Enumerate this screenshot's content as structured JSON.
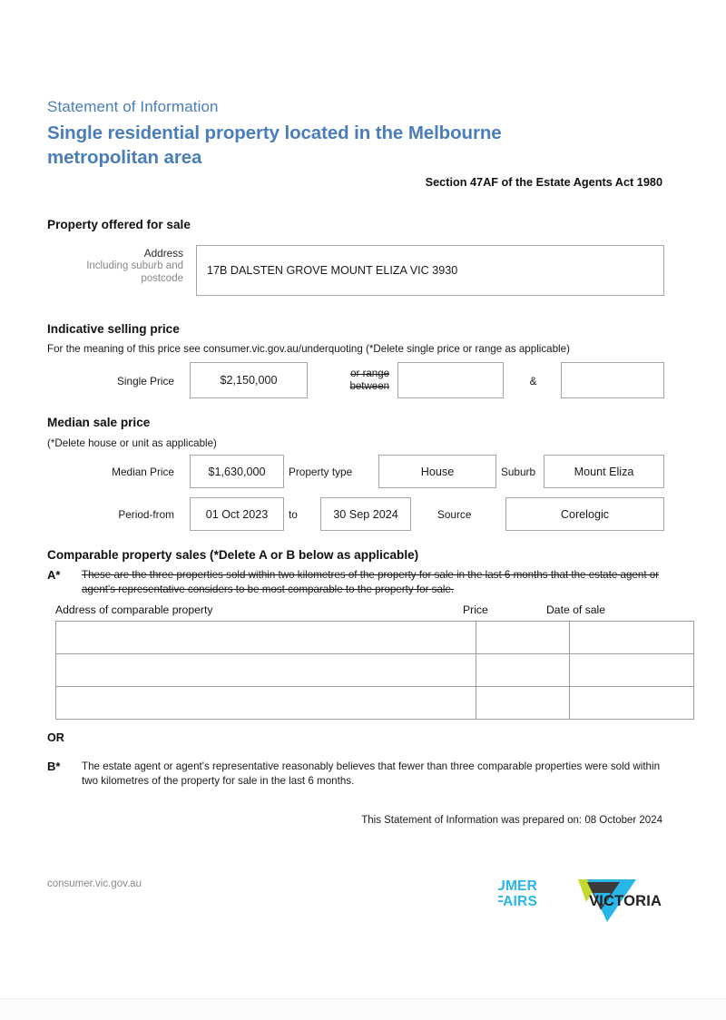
{
  "header": {
    "eyebrow": "Statement of Information",
    "title": "Single residential property located in the Melbourne metropolitan area",
    "section_ref": "Section 47AF of the Estate Agents Act 1980",
    "title_color": "#4a7ebb"
  },
  "property_offered": {
    "heading": "Property offered for sale",
    "address_label": "Address",
    "address_sublabel": "Including suburb and postcode",
    "address_value": "17B DALSTEN GROVE MOUNT ELIZA VIC 3930"
  },
  "indicative_price": {
    "heading": "Indicative selling price",
    "note": "For the meaning of this price see consumer.vic.gov.au/underquoting (*Delete single price or range as applicable)",
    "single_price_label": "Single Price",
    "single_price_value": "$2,150,000",
    "or_range_label_line1": "or range",
    "or_range_label_line2": "between",
    "range_low_value": "",
    "ampersand": "&",
    "range_high_value": ""
  },
  "median_price": {
    "heading": "Median sale price",
    "note": "(*Delete house or unit as applicable)",
    "median_price_label": "Median Price",
    "median_price_value": "$1,630,000",
    "property_type_label": "Property type",
    "property_type_value": "House",
    "suburb_label": "Suburb",
    "suburb_value": "Mount Eliza",
    "period_from_label": "Period-from",
    "period_from_value": "01 Oct 2023",
    "to_label": "to",
    "period_to_value": "30 Sep 2024",
    "source_label": "Source",
    "source_value": "Corelogic"
  },
  "comparable_sales": {
    "heading": "Comparable property sales (*Delete A or B below as applicable)",
    "option_a_marker": "A*",
    "option_a_text": "These are the three properties sold within two kilometres of the property for sale in the last 6 months that the estate agent or agent's representative considers to be most comparable to the property for sale.",
    "option_a_struck": true,
    "columns": [
      "Address of comparable property",
      "Price",
      "Date of sale"
    ],
    "rows": [
      {
        "address": "",
        "price": "",
        "date_of_sale": ""
      },
      {
        "address": "",
        "price": "",
        "date_of_sale": ""
      },
      {
        "address": "",
        "price": "",
        "date_of_sale": ""
      }
    ],
    "or_label": "OR",
    "option_b_marker": "B*",
    "option_b_text": "The estate agent or agent's representative reasonably believes that fewer than three comparable properties were sold within two kilometres of the property for sale in the last 6 months."
  },
  "prepared": {
    "text": "This Statement of Information was prepared on: 08 October 2024"
  },
  "footer": {
    "url": "consumer.vic.gov.au",
    "logo_line1": "CONSUMER",
    "logo_line2": "AFFAIRS",
    "logo_word": "VICTORIA",
    "logo_cyan": "#29b6e8",
    "logo_lime": "#c4d92e",
    "logo_dark": "#3b3b3b"
  }
}
